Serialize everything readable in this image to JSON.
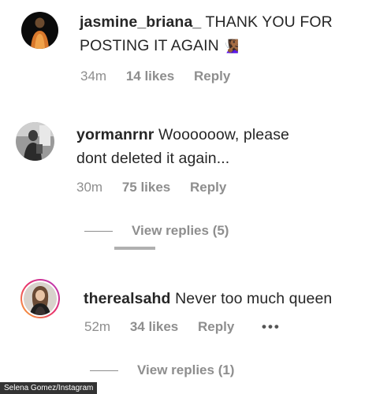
{
  "comments": [
    {
      "username": "jasmine_briana_",
      "text_line1": "THANK YOU FOR",
      "text_line2": "POSTING IT AGAIN",
      "emoji": "🧏🏾‍♀️",
      "time": "34m",
      "likes": "14 likes",
      "reply": "Reply"
    },
    {
      "username": "yormanrnr",
      "text_line1": "Woooooow, please",
      "text_line2": "dont deleted it again...",
      "time": "30m",
      "likes": "75 likes",
      "reply": "Reply",
      "view_replies": "View replies (5)"
    },
    {
      "username": "therealsahd",
      "text_line1": "Never too much queen",
      "time": "52m",
      "likes": "34 likes",
      "reply": "Reply",
      "more": "•••",
      "view_replies": "View replies (1)"
    }
  ],
  "credit": "Selena Gomez/Instagram"
}
